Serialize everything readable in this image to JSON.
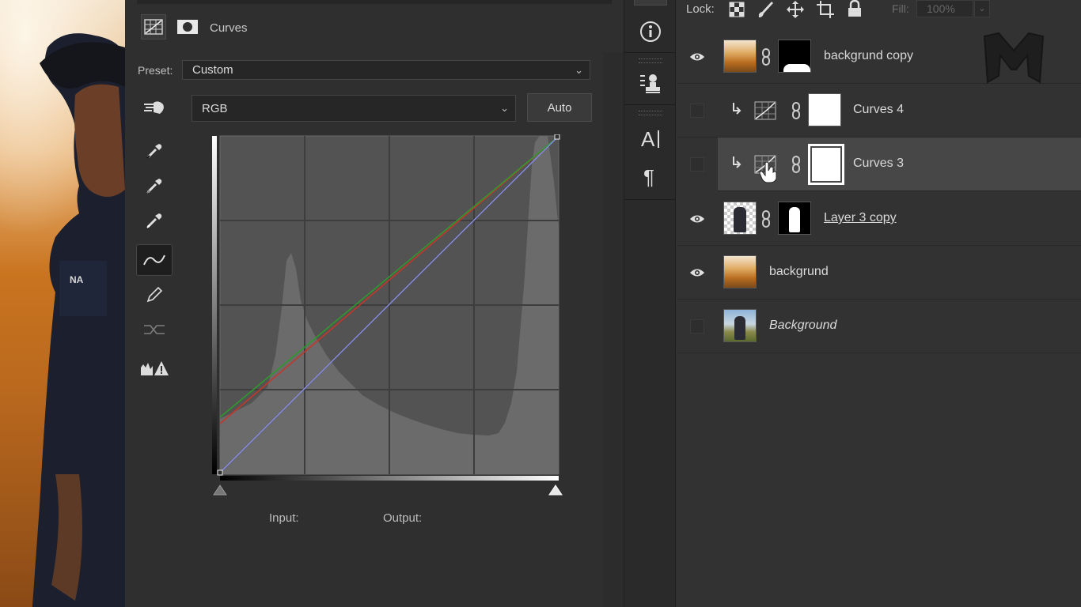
{
  "properties": {
    "title": "Curves",
    "preset_label": "Preset:",
    "preset_value": "Custom",
    "channel_value": "RGB",
    "auto_button": "Auto",
    "input_label": "Input:",
    "output_label": "Output:"
  },
  "layers": {
    "lock_label": "Lock:",
    "fill_label": "Fill:",
    "fill_value": "100%",
    "rows": [
      {
        "name": "backgrund copy",
        "visible": true
      },
      {
        "name": "Curves 4",
        "visible": false,
        "clipped": true
      },
      {
        "name": "Curves 3",
        "visible": false,
        "clipped": true,
        "selected": true
      },
      {
        "name": "Layer 3 copy",
        "visible": true
      },
      {
        "name": "backgrund",
        "visible": true
      },
      {
        "name": "Background",
        "visible": false,
        "italic": true
      }
    ]
  },
  "colors": {
    "panel_bg": "#2f2f2f",
    "selected_row": "#474747",
    "curve_red": "#c2372a",
    "curve_green": "#2e9a2e",
    "curve_blue": "#4a55d8"
  }
}
